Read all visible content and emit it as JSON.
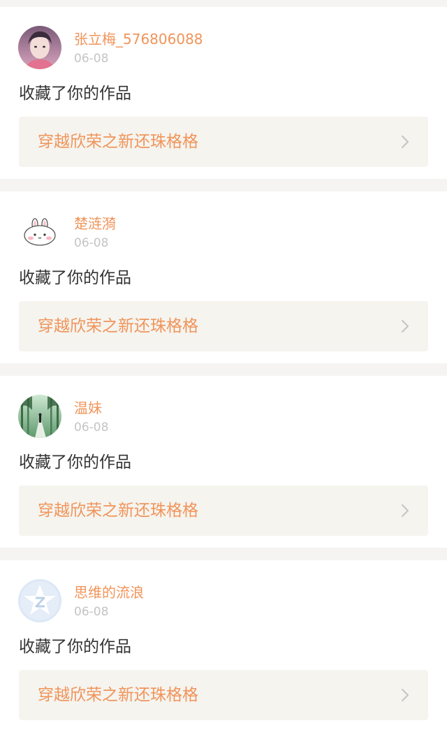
{
  "notifications": [
    {
      "username": "张立梅_576806088",
      "date": "06-08",
      "action": "收藏了你的作品",
      "work_title": "穿越欣荣之新还珠格格",
      "avatar_icon": "user-photo-avatar"
    },
    {
      "username": "楚涟漪",
      "date": "06-08",
      "action": "收藏了你的作品",
      "work_title": "穿越欣荣之新还珠格格",
      "avatar_icon": "bunny-avatar"
    },
    {
      "username": "温妹",
      "date": "06-08",
      "action": "收藏了你的作品",
      "work_title": "穿越欣荣之新还珠格格",
      "avatar_icon": "forest-path-avatar"
    },
    {
      "username": "思维的流浪",
      "date": "06-08",
      "action": "收藏了你的作品",
      "work_title": "穿越欣荣之新还珠格格",
      "avatar_icon": "default-z-star-avatar"
    }
  ],
  "colors": {
    "accent": "#f0945a",
    "date": "#c4c4c4",
    "body_text": "#333333",
    "link_bg": "#f5f4ef",
    "page_bg": "#f5f4f2"
  }
}
